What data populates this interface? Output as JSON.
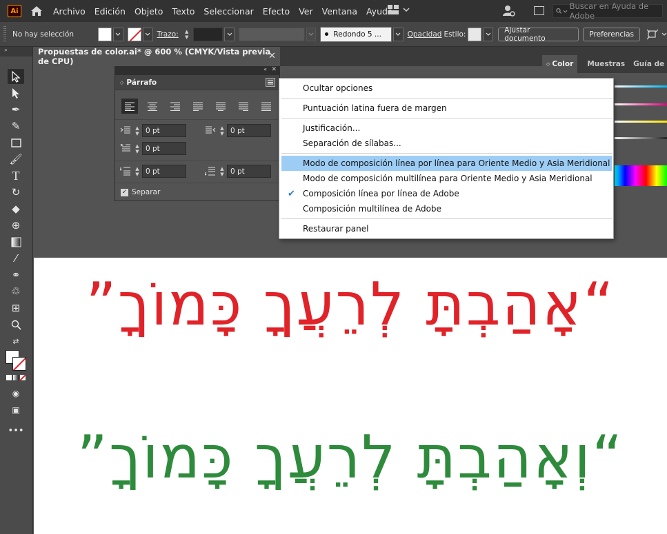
{
  "app": {
    "logo_text": "Ai"
  },
  "menubar": {
    "items": [
      "Archivo",
      "Edición",
      "Objeto",
      "Texto",
      "Seleccionar",
      "Efecto",
      "Ver",
      "Ventana",
      "Ayuda"
    ],
    "search_placeholder": "Buscar en Ayuda de Adobe"
  },
  "controlbar": {
    "selection_label": "No hay selección",
    "stroke_label": "Trazo:",
    "brush_label": "Redondo 5 ...",
    "opacity_label": "Opacidad",
    "style_label": "Estilo:",
    "adjust_doc_button": "Ajustar documento",
    "preferences_button": "Preferencias"
  },
  "document": {
    "tab_title": "Propuestas de color.ai* @ 600 % (CMYK/Vista previa de CPU)"
  },
  "color_panel": {
    "tabs": [
      "Color",
      "Muestras",
      "Guía de color"
    ],
    "bar_colors": [
      "#00b7f0",
      "#e5007e",
      "#ffe600",
      "#9a9a9a"
    ]
  },
  "paragraph_panel": {
    "title": "Párrafo",
    "left_indent": "0 pt",
    "right_indent": "0 pt",
    "first_line_indent": "0 pt",
    "space_before": "0 pt",
    "space_after": "0 pt",
    "hyphenate_label": "Separar",
    "hyphenate_checked": true
  },
  "flyout_menu": {
    "items": [
      "Ocultar opciones",
      "Puntuación latina fuera de margen",
      "Justificación...",
      "Separación de sílabas...",
      "Modo de composición línea por línea para Oriente Medio y Asia Meridional",
      "Modo de composición multilínea para Oriente Medio y Asia Meridional",
      "Composición línea por línea de Adobe",
      "Composición multilínea de Adobe",
      "Restaurar panel"
    ],
    "highlighted_index": 4,
    "checked_index": 6
  },
  "artboard": {
    "line1": "“אָהַבְתָּ לְרֵעֲךָ כָּמוֹךָ”",
    "line2": "“וְאָהַבְתָּ לְרֵעֲךָ כָּמוֹךָ”",
    "line1_color": "#e02329",
    "line2_color": "#2e8b3c"
  }
}
